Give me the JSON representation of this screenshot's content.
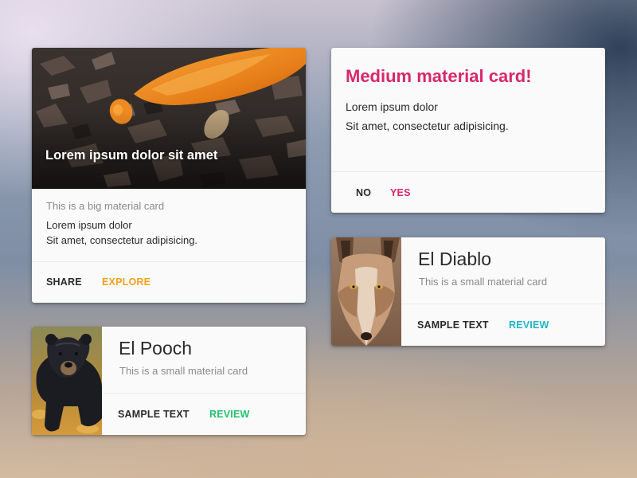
{
  "big_card": {
    "hero_title": "Lorem ipsum dolor sit amet",
    "subtitle": "This is a big material card",
    "body_line1": "Lorem ipsum dolor",
    "body_line2": "Sit amet, consectetur adipisicing.",
    "actions": [
      {
        "label": "SHARE",
        "color": "#2a2a2a"
      },
      {
        "label": "EXPLORE",
        "color": "#f4a01c"
      }
    ],
    "image": "balloon-on-bark-photo"
  },
  "medium_card": {
    "title": "Medium material card!",
    "title_color": "#d8286c",
    "body_line1": "Lorem ipsum dolor",
    "body_line2": "Sit amet, consectetur adipisicing.",
    "actions": [
      {
        "label": "NO",
        "color": "#2a2a2a"
      },
      {
        "label": "YES",
        "color": "#d8286c"
      }
    ]
  },
  "small_cards": [
    {
      "title": "El Diablo",
      "subtitle": "This is a small material card",
      "image": "coyote-photo",
      "actions": [
        {
          "label": "SAMPLE TEXT",
          "color": "#2a2a2a"
        },
        {
          "label": "REVIEW",
          "color": "#1fb6c9"
        }
      ]
    },
    {
      "title": "El Pooch",
      "subtitle": "This is a small material card",
      "image": "black-bear-photo",
      "actions": [
        {
          "label": "SAMPLE TEXT",
          "color": "#2a2a2a"
        },
        {
          "label": "REVIEW",
          "color": "#21c36b"
        }
      ]
    }
  ]
}
